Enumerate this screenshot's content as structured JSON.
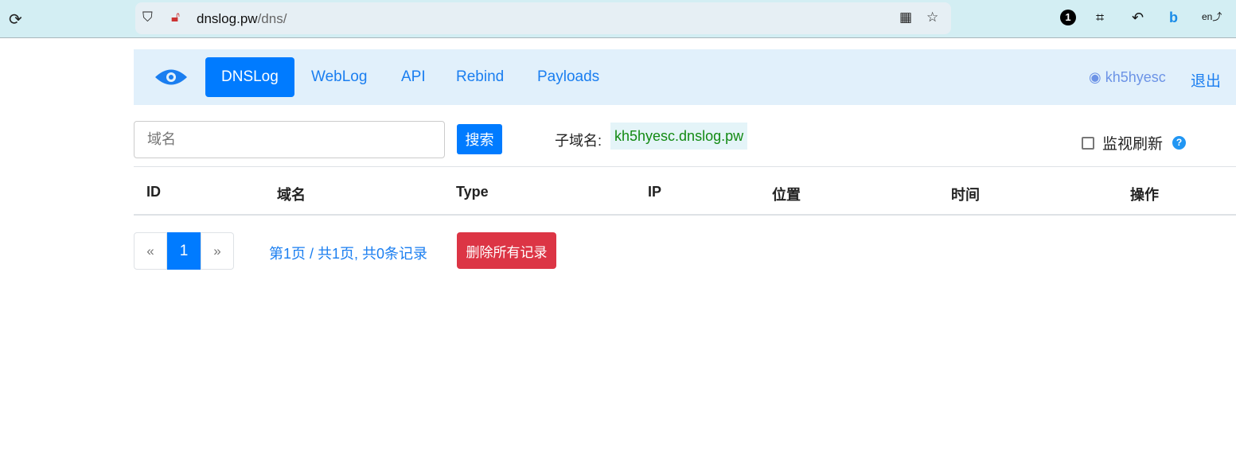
{
  "browser": {
    "url_host": "dnslog.pw",
    "url_path": "/dns/",
    "badge_count": "1"
  },
  "nav": {
    "tabs": [
      "DNSLog",
      "WebLog",
      "API",
      "Rebind",
      "Payloads"
    ],
    "username": "kh5hyesc",
    "logout": "退出"
  },
  "toolbar": {
    "search_placeholder": "域名",
    "search_button": "搜索",
    "subdomain_label": "子域名:",
    "subdomain_value": "kh5hyesc.dnslog.pw",
    "monitor_label": "监视刷新",
    "help": "?"
  },
  "table": {
    "headers": [
      "ID",
      "域名",
      "Type",
      "IP",
      "位置",
      "时间",
      "操作"
    ]
  },
  "pagination": {
    "prev": "«",
    "current": "1",
    "next": "»",
    "info": "第1页 / 共1页, 共0条记录",
    "delete_all": "删除所有记录"
  }
}
